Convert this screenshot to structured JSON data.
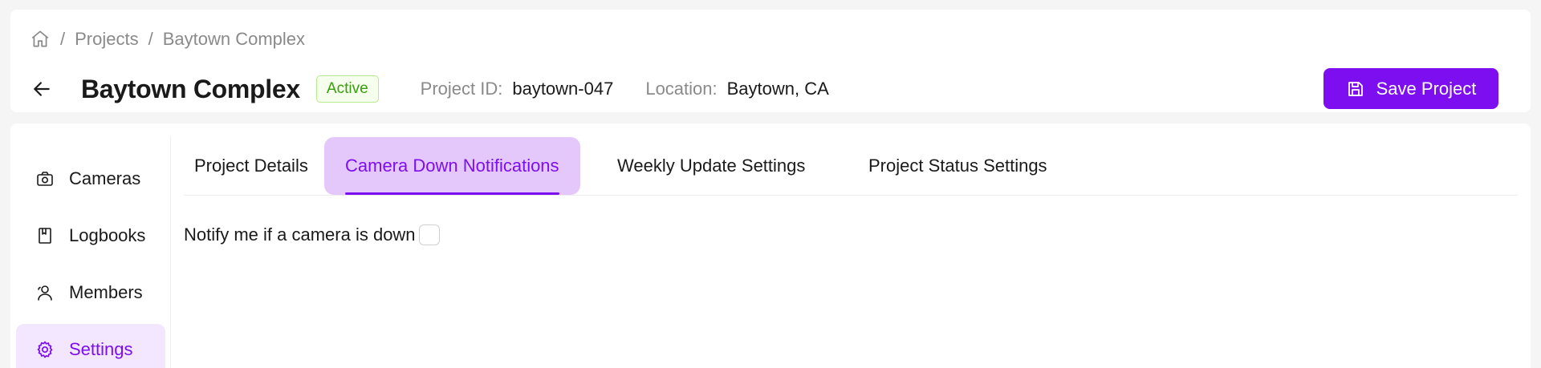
{
  "breadcrumb": {
    "home_icon": "home-icon",
    "items": [
      "Projects",
      "Baytown Complex"
    ],
    "separator": "/"
  },
  "header": {
    "title": "Baytown Complex",
    "status": "Active",
    "project_id_label": "Project ID:",
    "project_id": "baytown-047",
    "location_label": "Location:",
    "location": "Baytown, CA",
    "save_label": "Save Project"
  },
  "sidebar": {
    "items": [
      {
        "label": "Cameras",
        "icon": "camera-icon"
      },
      {
        "label": "Logbooks",
        "icon": "book-icon"
      },
      {
        "label": "Members",
        "icon": "users-icon"
      },
      {
        "label": "Settings",
        "icon": "gear-icon",
        "active": true
      }
    ]
  },
  "tabs": [
    {
      "label": "Project Details"
    },
    {
      "label": "Camera Down Notifications",
      "active": true
    },
    {
      "label": "Weekly Update Settings"
    },
    {
      "label": "Project Status Settings"
    }
  ],
  "content": {
    "notify_label": "Notify me if a camera is down",
    "notify_checked": false
  },
  "colors": {
    "accent": "#7c0ef0",
    "accent_light": "#e5c8fb",
    "sidebar_active_bg": "#f3e6ff",
    "status_green": "#389e0d"
  }
}
